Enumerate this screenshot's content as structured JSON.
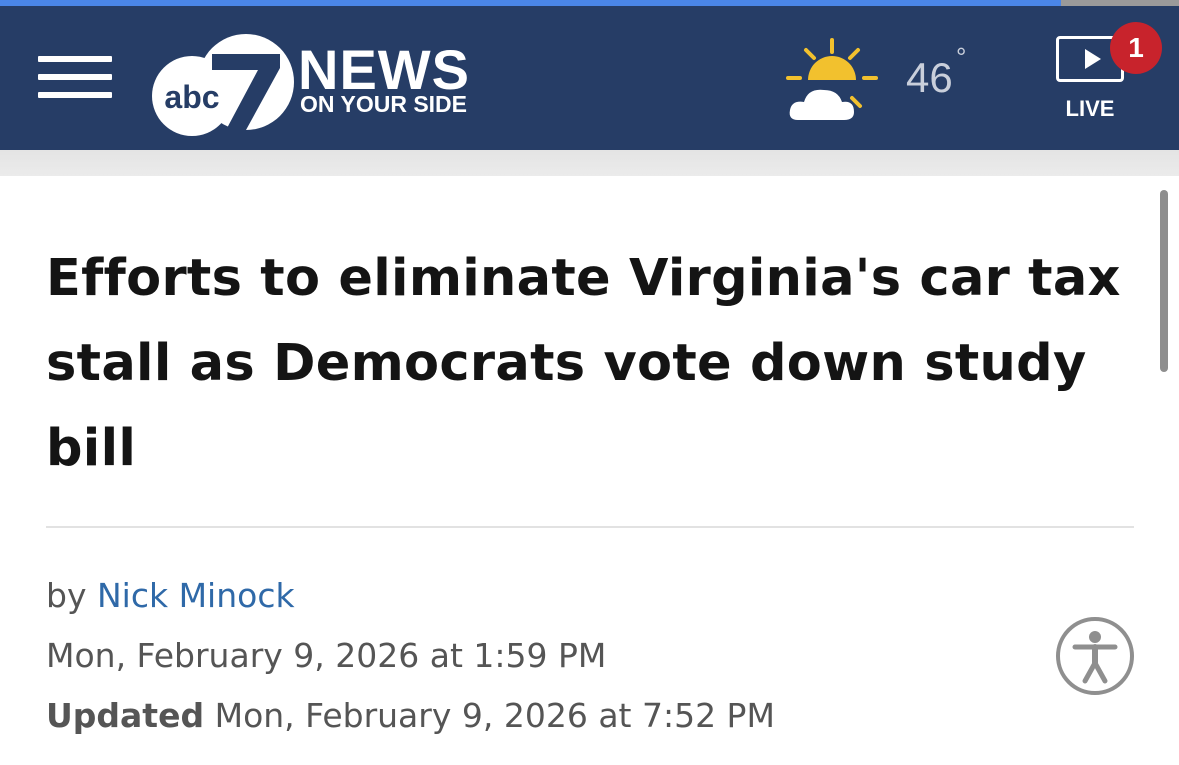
{
  "page_progress": 0.9,
  "header": {
    "menu_icon": "hamburger-menu-icon",
    "logo": {
      "brand": "abc7",
      "title": "NEWS",
      "tagline": "ON YOUR SIDE"
    },
    "weather": {
      "icon": "partly-cloudy-icon",
      "temperature": "46",
      "degree_symbol": "°"
    },
    "live": {
      "icon": "play-screen-icon",
      "label": "LIVE",
      "badge_count": "1"
    },
    "background_color": "#263d66",
    "badge_color": "#c8232c",
    "sun_color": "#f2c12e"
  },
  "article": {
    "headline": "Efforts to eliminate Virginia's car tax stall as Democrats vote down study bill",
    "byline_prefix": "by",
    "author": "Nick Minock",
    "published": "Mon, February 9, 2026 at 1:59 PM",
    "updated_label": "Updated",
    "updated": "Mon, February 9, 2026 at 7:52 PM",
    "author_link_color": "#2f69a8"
  },
  "accessibility_button": {
    "icon": "accessibility-person-icon"
  }
}
